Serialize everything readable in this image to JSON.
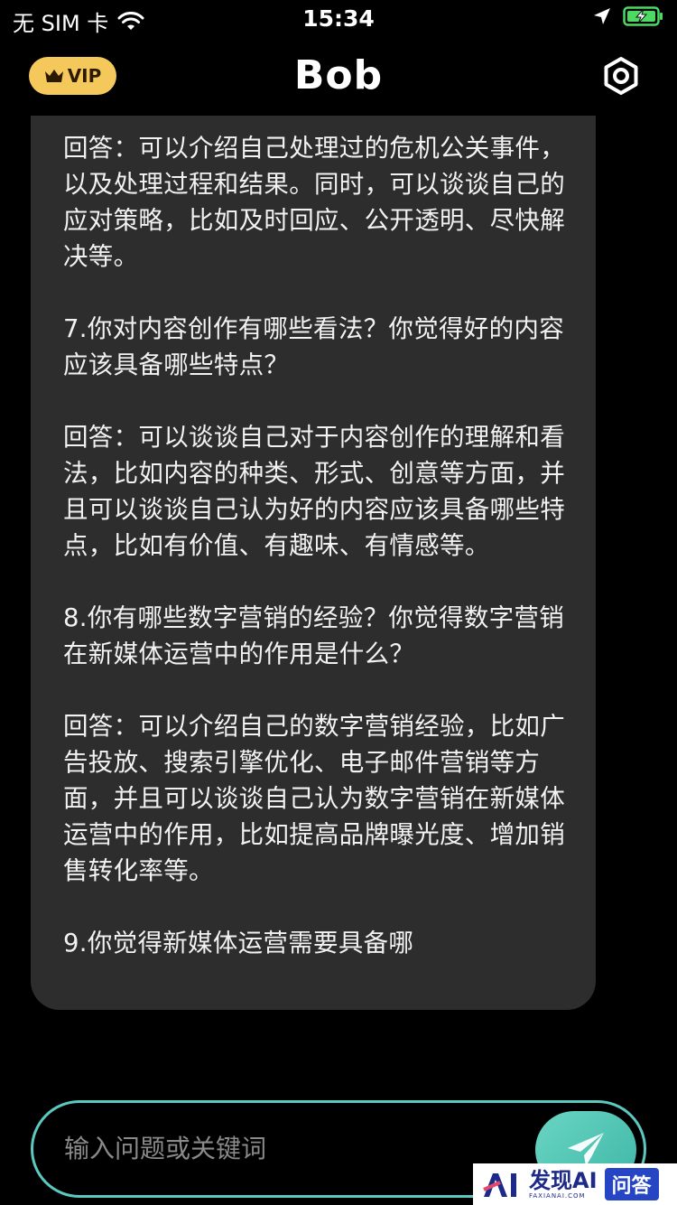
{
  "status_bar": {
    "carrier": "无 SIM 卡",
    "time": "15:34"
  },
  "header": {
    "vip_label": "VIP",
    "title": "Bob"
  },
  "chat": {
    "paragraphs": [
      "回答：可以介绍自己处理过的危机公关事件，以及处理过程和结果。同时，可以谈谈自己的应对策略，比如及时回应、公开透明、尽快解决等。",
      "7.你对内容创作有哪些看法？你觉得好的内容应该具备哪些特点？",
      "回答：可以谈谈自己对于内容创作的理解和看法，比如内容的种类、形式、创意等方面，并且可以谈谈自己认为好的内容应该具备哪些特点，比如有价值、有趣味、有情感等。",
      "8.你有哪些数字营销的经验？你觉得数字营销在新媒体运营中的作用是什么？",
      "回答：可以介绍自己的数字营销经验，比如广告投放、搜索引擎优化、电子邮件营销等方面，并且可以谈谈自己认为数字营销在新媒体运营中的作用，比如提高品牌曝光度、增加销售转化率等。",
      "9.你觉得新媒体运营需要具备哪"
    ]
  },
  "input": {
    "placeholder": "输入问题或关键词"
  },
  "watermark": {
    "brand": "发现AI",
    "domain": "FAXIANAI.COM",
    "badge": "问答"
  },
  "colors": {
    "vip_gold": "#f4c85a",
    "bubble_bg": "#2d2d2d",
    "input_border": "#5cc9c0",
    "send_button": "#4fc4b2",
    "battery_green": "#4cd964"
  },
  "icons": [
    "wifi-icon",
    "location-icon",
    "battery-charging-icon",
    "crown-icon",
    "settings-icon",
    "send-icon"
  ]
}
